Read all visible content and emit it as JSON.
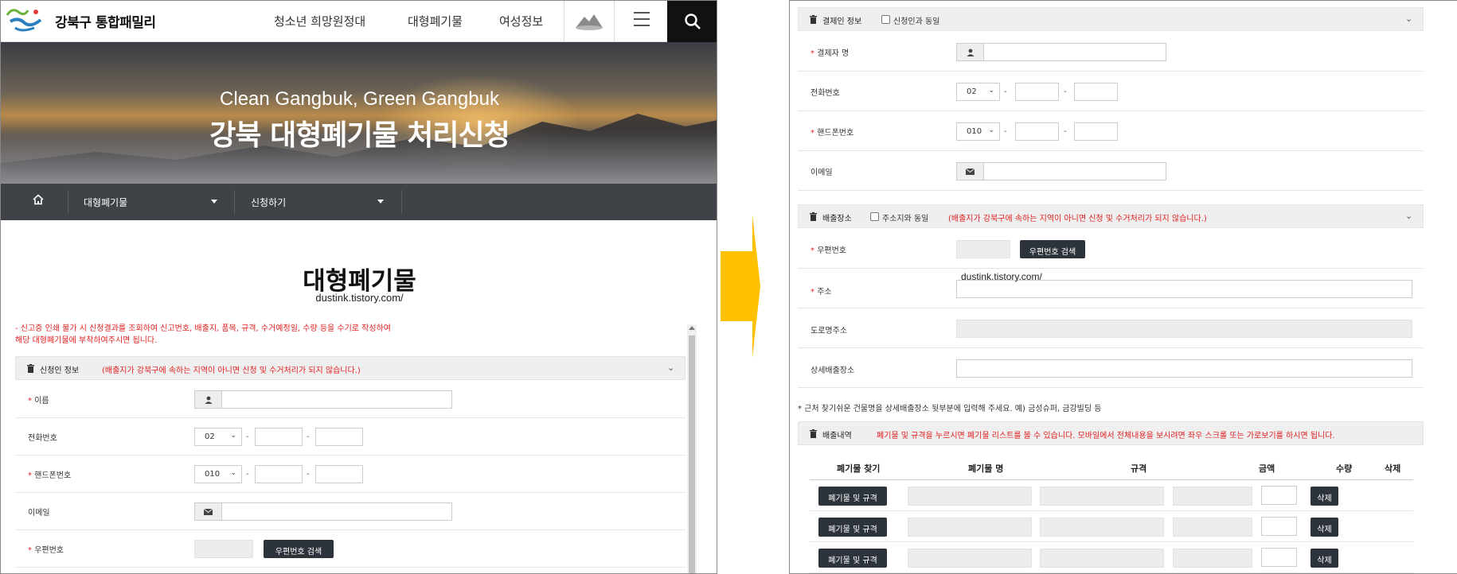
{
  "header": {
    "logo_text": "강북구 통합패밀리",
    "nav": [
      "청소년 희망원정대",
      "대형폐기물",
      "여성정보"
    ]
  },
  "hero": {
    "title_en": "Clean Gangbuk, Green Gangbuk",
    "title_ko": "강북 대형폐기물 처리신청"
  },
  "breadcrumb": {
    "items": [
      "대형폐기물",
      "신청하기"
    ]
  },
  "main": {
    "title": "대형폐기물",
    "watermark": "dustink.tistory.com/",
    "notice_line1": "- 신고증 인쇄 불가 시 신청결과를 조회하여 신고번호, 배출지, 품목, 규격, 수거예정일, 수량 등을 수기로 작성하여",
    "notice_line2": "해당 대형폐기물에 부착하여주시면 됩니다."
  },
  "applicant": {
    "title": "신청인 정보",
    "warning": "(배출지가 강북구에 속하는 지역이 아니면 신청 및 수거처리가 되지 않습니다.)",
    "name_label": "이름",
    "phone_label": "전화번호",
    "phone_prefix": "02",
    "mobile_label": "핸드폰번호",
    "mobile_prefix": "010",
    "email_label": "이메일",
    "postcode_label": "우편번호",
    "postcode_button": "우편번호 검색"
  },
  "payer": {
    "title": "결제인 정보",
    "same_as_label": "신청인과 동일",
    "name_label": "결제자 명",
    "phone_label": "전화번호",
    "phone_prefix": "02",
    "mobile_label": "핸드폰번호",
    "mobile_prefix": "010",
    "email_label": "이메일"
  },
  "discharge_place": {
    "title": "배출장소",
    "same_as_label": "주소지와 동일",
    "warning": "(배출지가 강북구에 속하는 지역이 아니면 신청 및 수거처리가 되지 않습니다.)",
    "postcode_label": "우편번호",
    "postcode_button": "우편번호 검색",
    "address_label": "주소",
    "address_watermark": "dustink.tistory.com/",
    "road_address_label": "도로명주소",
    "detail_label": "상세배출장소",
    "hint": "* 근처 찾기쉬운 건물명을 상세배출장소 뒷부분에 입력해 주세요. 예) 금성슈퍼, 금강빌딩 등"
  },
  "items": {
    "title": "배출내역",
    "notice": "폐기물 및 규격을 누르시면 폐기물 리스트를 볼 수 있습니다.  모바일에서 전체내용을 보시려면 좌우 스크롤 또는 가로보기를 하시면 됩니다.",
    "columns": [
      "폐기물 찾기",
      "폐기물 명",
      "규격",
      "금액",
      "수량",
      "삭제"
    ],
    "find_button": "폐기물 및 규격",
    "delete_button": "삭제"
  },
  "colors": {
    "accent_red": "#e02020",
    "dark_button": "#2c333a",
    "arrow": "#ffc000",
    "breadcrumb_bg": "#3f4246"
  }
}
